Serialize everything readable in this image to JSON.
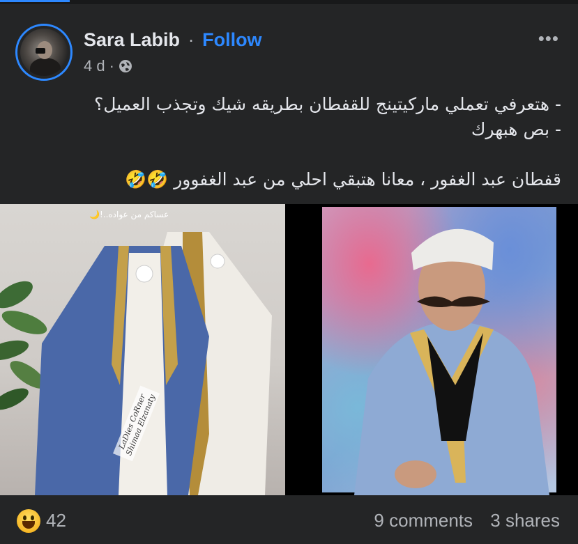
{
  "post": {
    "author": "Sara Labib",
    "separator": "·",
    "follow_label": "Follow",
    "time": "4 d",
    "time_sep": "·",
    "privacy_icon": "globe-icon",
    "more_label": "•••",
    "text_lines": [
      "- هتعرفي تعملي ماركيتينج للقفطان بطريقه شيك وتجذب العميل؟",
      "- بص هبهرك",
      "",
      "قفطان عبد الغفور ، معانا هتبقي احلي من عبد الغفوور 🤣🤣"
    ],
    "image_caption": "عساكم من عواده..!🌙",
    "watermark_line1": "LaDies CoRner",
    "watermark_line2": "Shimaa Elzanaty"
  },
  "footer": {
    "reaction_icon": "haha-emoji-icon",
    "reaction_count": "42",
    "comments": "9 comments",
    "shares": "3 shares"
  },
  "colors": {
    "background": "#242526",
    "accent": "#2d88ff",
    "secondary_text": "#b0b3b8"
  }
}
